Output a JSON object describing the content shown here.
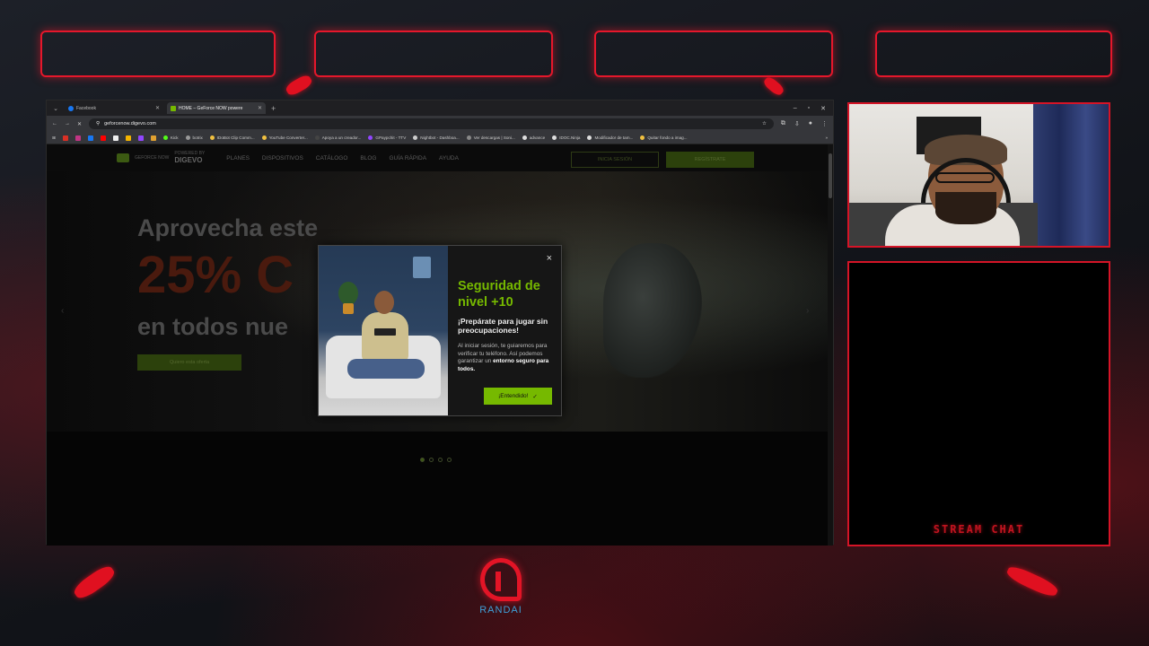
{
  "browser": {
    "tabs": [
      {
        "label": "Facebook",
        "active": false
      },
      {
        "label": "HOME – GeForce NOW powere",
        "active": true
      }
    ],
    "url": "geforcenow.digevo.com",
    "bookmarks": [
      "Kick",
      "botrix",
      "IDoBot Clip Comm...",
      "YouTube Converter...",
      "Apoya a un creador...",
      "GPaypchit - TTV",
      "Nightbot - Dashboa...",
      "Ver descargas | Soni...",
      "advance",
      "IDOC.Ninja",
      "Modificador de tam...",
      "Quitar fondo a imag..."
    ]
  },
  "site": {
    "logo_top": "GEFORCE NOW",
    "logo_powered": "POWERED BY",
    "logo_brand": "DIGEVO",
    "nav": [
      "PLANES",
      "DISPOSITIVOS",
      "CATÁLOGO",
      "BLOG",
      "GUÍA RÁPIDA",
      "AYUDA"
    ],
    "login": "INICIA SESIÓN",
    "register": "REGÍSTRATE",
    "hero_line1": "Aprovecha este",
    "hero_line2": "25% C",
    "hero_line3": "en todos nue",
    "hero_cta": "Quiero esta oferta"
  },
  "modal": {
    "title": "Seguridad de nivel +10",
    "subtitle": "¡Prepárate para jugar sin preocupaciones!",
    "desc_plain": "Al iniciar sesión, te guiaremos para verificar tu teléfono. Así podemos garantizar un",
    "desc_bold": "entorno seguro para todos.",
    "ok_label": "¡Entendido!",
    "close": "×"
  },
  "overlay": {
    "chat_label": "STREAM CHAT",
    "brand_name": "RANDAI"
  },
  "colors": {
    "accent": "#76b900",
    "overlay_red": "#e5172b"
  }
}
